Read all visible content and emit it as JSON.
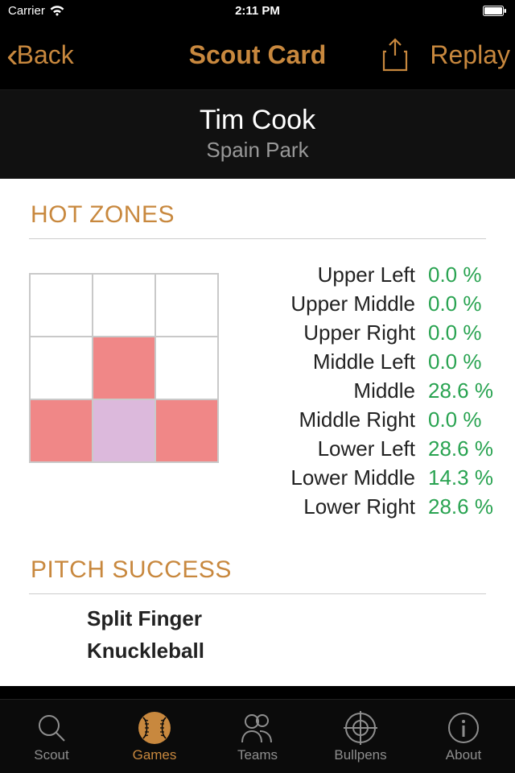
{
  "status": {
    "carrier": "Carrier",
    "time": "2:11 PM"
  },
  "nav": {
    "back": "Back",
    "title": "Scout Card",
    "replay": "Replay"
  },
  "player": {
    "name": "Tim Cook",
    "team": "Spain Park"
  },
  "sections": {
    "hot_zones": "HOT ZONES",
    "pitch_success": "PITCH SUCCESS"
  },
  "zones": {
    "grid": [
      {
        "level": 0
      },
      {
        "level": 0
      },
      {
        "level": 0
      },
      {
        "level": 0
      },
      {
        "level": 1
      },
      {
        "level": 0
      },
      {
        "level": 1
      },
      {
        "level": 2
      },
      {
        "level": 1
      }
    ],
    "stats": [
      {
        "label": "Upper Left",
        "val": "0.0 %"
      },
      {
        "label": "Upper Middle",
        "val": "0.0 %"
      },
      {
        "label": "Upper Right",
        "val": "0.0 %"
      },
      {
        "label": "Middle Left",
        "val": "0.0 %"
      },
      {
        "label": "Middle",
        "val": "28.6 %"
      },
      {
        "label": "Middle Right",
        "val": "0.0 %"
      },
      {
        "label": "Lower Left",
        "val": "28.6 %"
      },
      {
        "label": "Lower Middle",
        "val": "14.3 %"
      },
      {
        "label": "Lower Right",
        "val": "28.6 %"
      }
    ]
  },
  "pitches": [
    "Split Finger",
    "Knuckleball"
  ],
  "tabs": [
    {
      "label": "Scout"
    },
    {
      "label": "Games"
    },
    {
      "label": "Teams"
    },
    {
      "label": "Bullpens"
    },
    {
      "label": "About"
    }
  ],
  "active_tab": 1,
  "colors": {
    "accent": "#c8883e",
    "statgreen": "#29a351"
  }
}
